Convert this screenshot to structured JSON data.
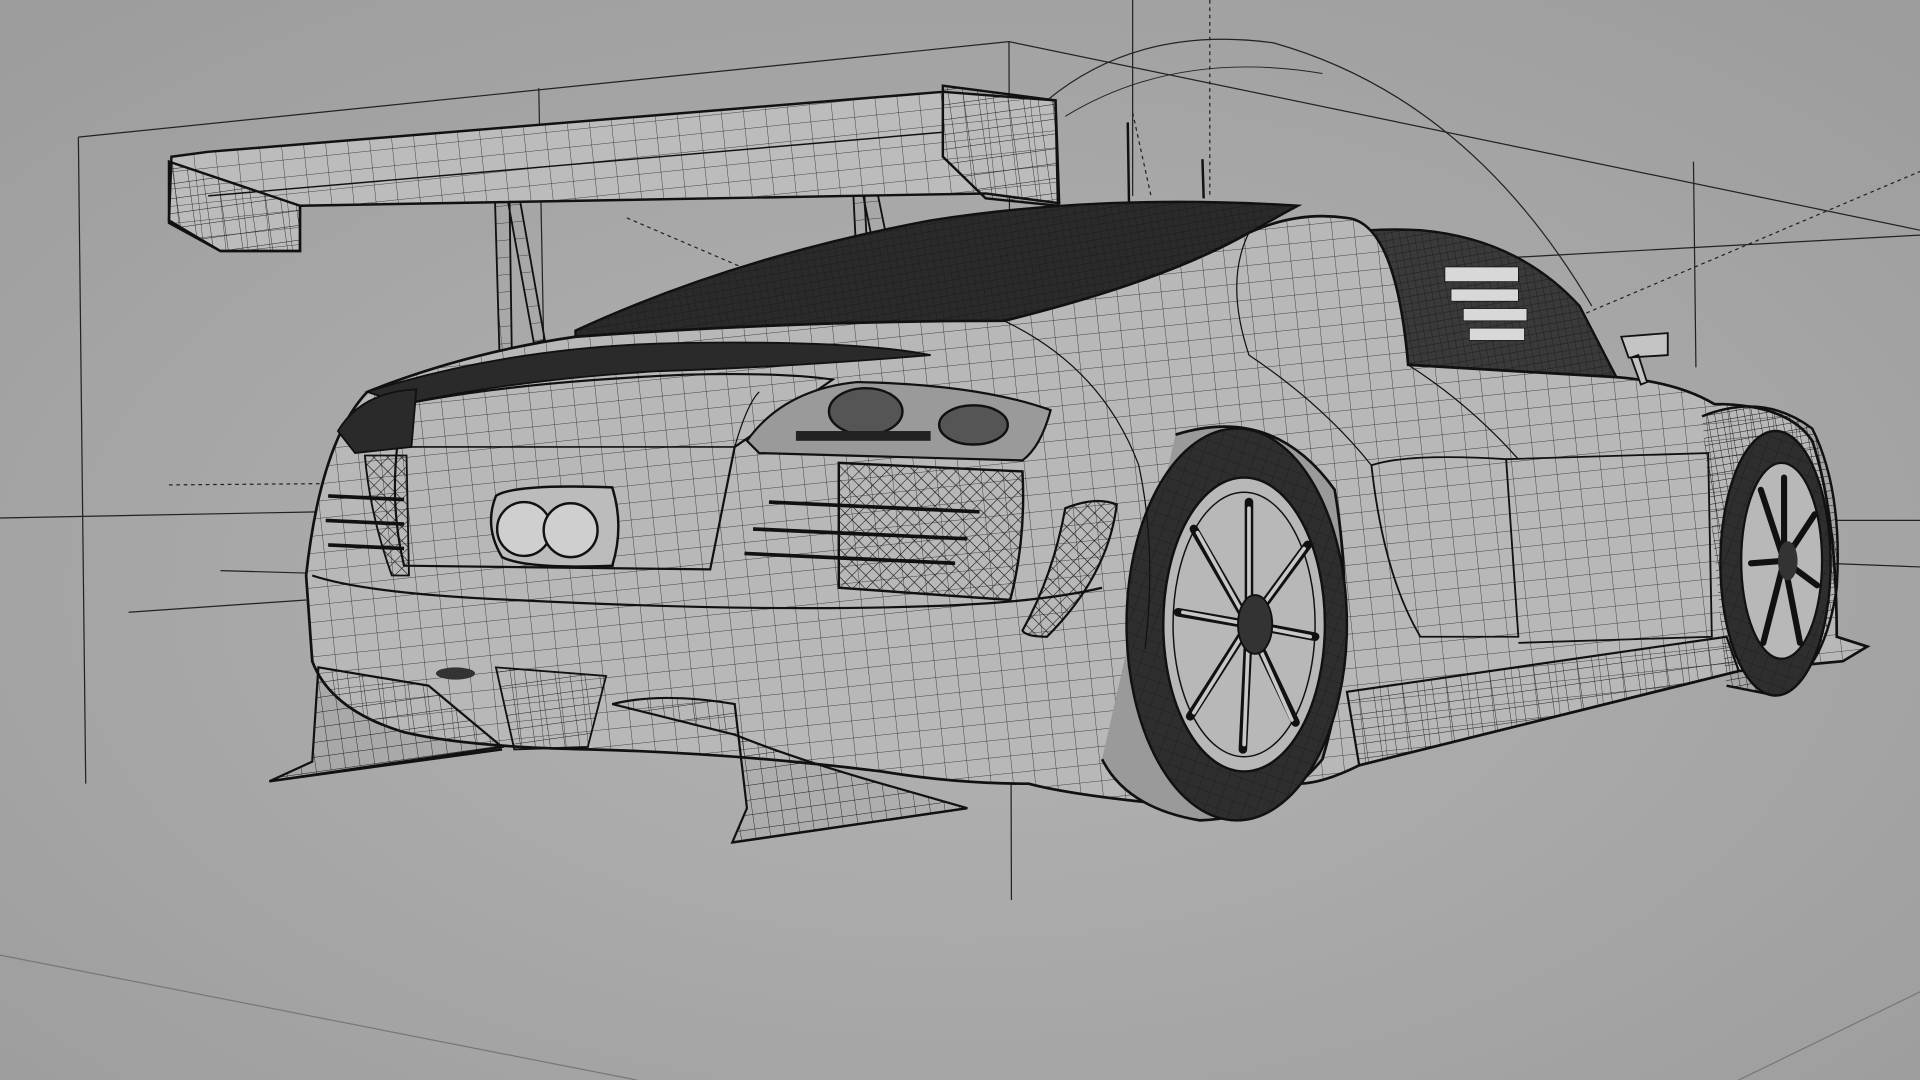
{
  "scene": {
    "subject": "wireframe-race-car",
    "background_color": "#a9a9a9",
    "wire_color": "#1a1a1a",
    "guide_color": "#222222",
    "tire_color": "#2a2a2a"
  }
}
